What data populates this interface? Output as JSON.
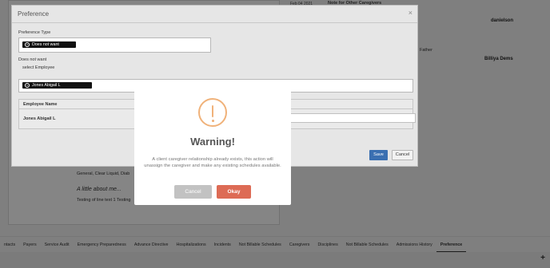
{
  "background": {
    "top_date": "Feb 04 2021",
    "top_notice": "Note for Other Caregivers",
    "right_user": "danielson",
    "father_label": "Father",
    "right_name": "Billiya Dems",
    "diet_text": "General, Clear Liquid, Diab",
    "about_title": "A little about me...",
    "about_text": "Testing of line text 1 Testing",
    "tabs": [
      "ntacts",
      "Payers",
      "Service Audit",
      "Emergency Preparedness",
      "Advance Directive",
      "Hospitalizations",
      "Incidents",
      "Not Billable Schedules",
      "Caregivers",
      "Disciplines",
      "Not Billable Schedules",
      "Admissions History",
      "Preference"
    ],
    "plus_label": "+"
  },
  "preference_modal": {
    "title": "Preference",
    "close_glyph": "×",
    "type_label": "Preference Type",
    "type_chip": "Does not want",
    "section_label": "Does not want",
    "employee_label": "select Employee",
    "employee_chip": "Jones Abigail L",
    "table": {
      "header": "Employee Name",
      "rows": [
        "Jones Abigail L"
      ]
    },
    "save_label": "Save",
    "cancel_label": "Cancel"
  },
  "warning_dialog": {
    "title": "Warning!",
    "message": "A client caregiver relationship already exists, this action will unassign the caregiver and make any existing schedules available.",
    "cancel_label": "Cancel",
    "ok_label": "Okay",
    "icon": "exclamation-circle-icon"
  },
  "colors": {
    "warning_icon": "#f0b27a",
    "okay_button": "#dd6b55",
    "cancel_button": "#c2c2c2",
    "save_button": "#3a6fb1",
    "chip_bg": "#111111"
  }
}
